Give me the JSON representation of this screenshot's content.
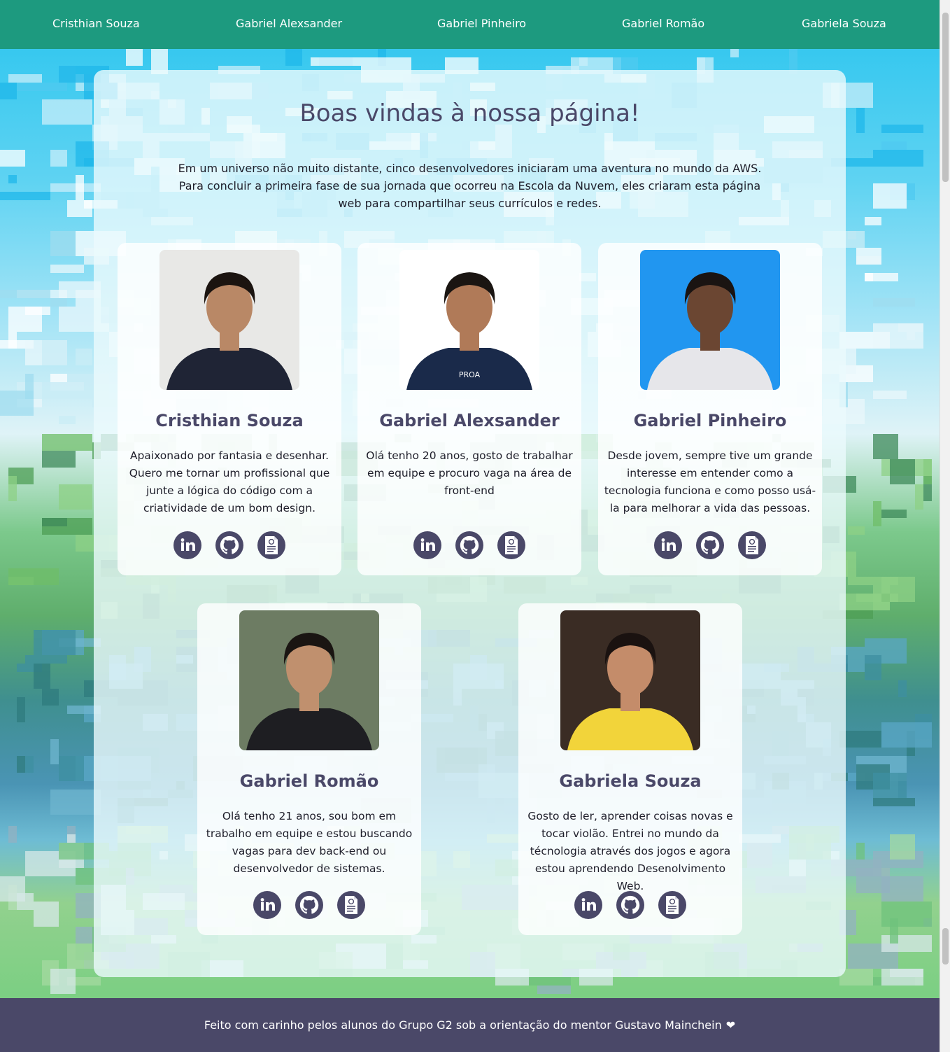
{
  "nav": {
    "links": [
      {
        "label": "Cristhian Souza"
      },
      {
        "label": "Gabriel Alexsander"
      },
      {
        "label": "Gabriel Pinheiro"
      },
      {
        "label": "Gabriel Romão"
      },
      {
        "label": "Gabriela Souza"
      }
    ]
  },
  "main": {
    "title": "Boas vindas à nossa página!",
    "intro": "Em um universo não muito distante, cinco desenvolvedores iniciaram uma aventura no mundo da AWS. Para concluir a primeira fase de sua jornada que ocorreu na Escola da Nuvem, eles criaram esta página web para compartilhar seus currículos e redes."
  },
  "cards": [
    {
      "name": "Cristhian Souza",
      "bio": "Apaixonado por fantasia e desenhar. Quero me tornar um profissional que junte a lógica do código com a criatividade de um bom design.",
      "photo_bg": "#e8e8e6",
      "shirt": "#1f2435",
      "skin": "#b98866",
      "hair": "#1b1410"
    },
    {
      "name": "Gabriel Alexsander",
      "bio": "Olá tenho 20 anos, gosto de trabalhar em equipe e procuro vaga na área de front-end",
      "photo_bg": "#ffffff",
      "shirt": "#1a2a4a",
      "skin": "#b07a58",
      "hair": "#1a1512",
      "shirt_text": "PROA"
    },
    {
      "name": "Gabriel Pinheiro",
      "bio": "Desde jovem, sempre tive um grande interesse em entender como a tecnologia funciona e como posso usá-la para melhorar a vida das pessoas.",
      "photo_bg": "#2196f0",
      "shirt": "#e6e6ea",
      "skin": "#6b4632",
      "hair": "#1a1412"
    },
    {
      "name": "Gabriel Romão",
      "bio": "Olá tenho 21 anos, sou bom em trabalho em equipe e estou buscando vagas para dev back-end ou desenvolvedor de sistemas.",
      "photo_bg": "#6d7c63",
      "shirt": "#1e1e22",
      "skin": "#c0906e",
      "hair": "#1a1512"
    },
    {
      "name": "Gabriela Souza",
      "bio": "Gosto de ler, aprender coisas novas e tocar violão. Entrei no mundo da técnologia através dos jogos e agora estou aprendendo Desenolvimento Web.",
      "photo_bg": "#3a2c24",
      "shirt": "#f2d43a",
      "skin": "#c48c6a",
      "hair": "#1a1210"
    }
  ],
  "icons": [
    "linkedin-icon",
    "github-icon",
    "resume-icon"
  ],
  "footer": {
    "text": "Feito com carinho pelos alunos do Grupo G2 sob a orientação do mentor Gustavo Mainchein",
    "heart": "❤"
  },
  "colors": {
    "nav_bg": "#1d9a7f",
    "accent": "#4a4868",
    "footer_bg": "#4a4868"
  }
}
